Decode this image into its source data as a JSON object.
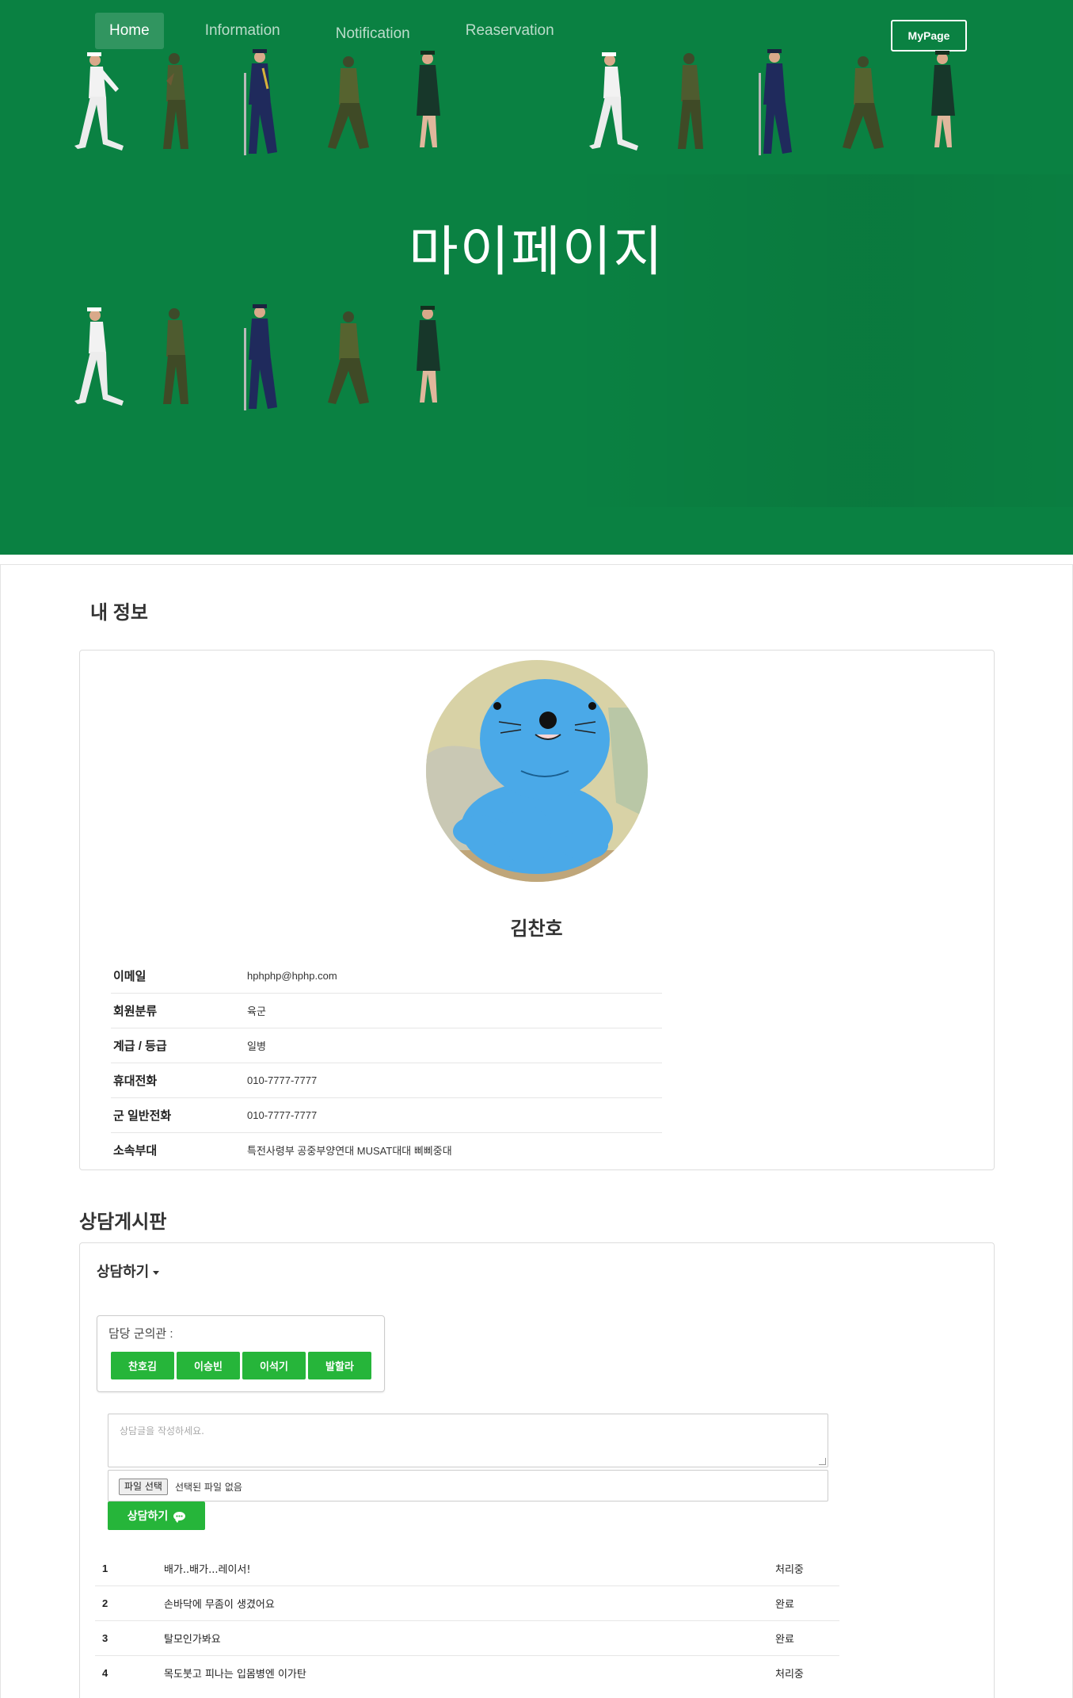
{
  "nav": {
    "items": [
      {
        "label": "Home",
        "active": true
      },
      {
        "label": "Information",
        "active": false
      },
      {
        "label": "Notification",
        "active": false
      },
      {
        "label": "Reaservation",
        "active": false
      }
    ],
    "mypage_label": "MyPage"
  },
  "hero": {
    "title": "마이페이지",
    "background": "#0a8142"
  },
  "myinfo": {
    "heading": "내 정보",
    "name": "김찬호",
    "fields": [
      {
        "label": "이메일",
        "value": "hphphp@hphp.com"
      },
      {
        "label": "회원분류",
        "value": "육군"
      },
      {
        "label": "계급 / 등급",
        "value": "일병"
      },
      {
        "label": "휴대전화",
        "value": "010-7777-7777"
      },
      {
        "label": "군 일반전화",
        "value": "010-7777-7777"
      },
      {
        "label": "소속부대",
        "value": "특전사령부 공중부양연대 MUSAT대대 삐삐중대"
      }
    ]
  },
  "board": {
    "heading": "상담게시판",
    "toggle_label": "상담하기",
    "doctor_label": "담당 군의관 :",
    "doctors": [
      "찬호김",
      "이승빈",
      "이석기",
      "발할라"
    ],
    "textarea_placeholder": "상담글을 작성하세요.",
    "file_button": "파일 선택",
    "file_status": "선택된 파일 없음",
    "submit_label": "상담하기",
    "accent": "#26b53a",
    "posts": [
      {
        "no": "1",
        "title": "배가..배가...레이서!",
        "status": "처리중"
      },
      {
        "no": "2",
        "title": "손바닥에 무좀이 생겼어요",
        "status": "완료"
      },
      {
        "no": "3",
        "title": "탈모인가봐요",
        "status": "완료"
      },
      {
        "no": "4",
        "title": "목도붓고 피나는 입몸병엔 이가탄",
        "status": "처리중"
      }
    ]
  }
}
